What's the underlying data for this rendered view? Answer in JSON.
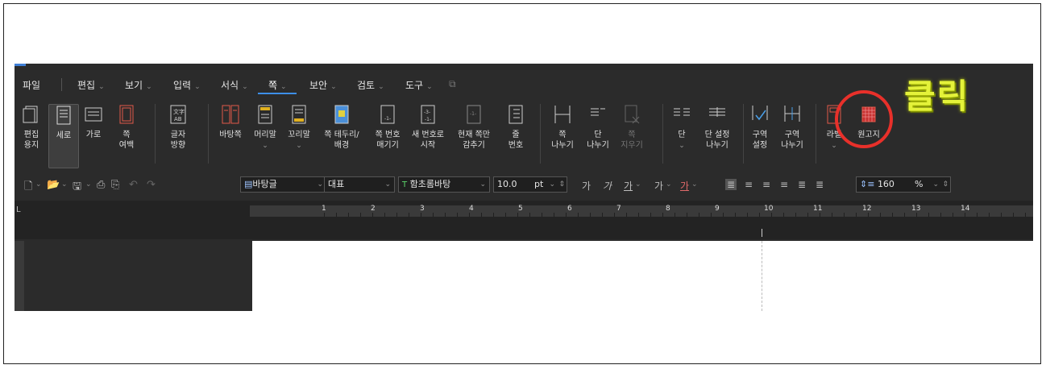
{
  "menu": {
    "items": [
      {
        "label": "파일"
      },
      {
        "label": "편집"
      },
      {
        "label": "보기"
      },
      {
        "label": "입력"
      },
      {
        "label": "서식"
      },
      {
        "label": "쪽"
      },
      {
        "label": "보안"
      },
      {
        "label": "검토"
      },
      {
        "label": "도구"
      }
    ],
    "active": "쪽"
  },
  "ribbon": {
    "buttons": [
      {
        "label": "편집\n용지",
        "icon": "edit-paper-icon"
      },
      {
        "label": "세로",
        "icon": "portrait-icon",
        "selected": true
      },
      {
        "label": "가로",
        "icon": "landscape-icon"
      },
      {
        "label": "쪽\n여백",
        "icon": "page-margin-icon"
      },
      {
        "label": "글자\n방향",
        "icon": "text-direction-icon"
      },
      {
        "label": "바탕쪽",
        "icon": "master-page-icon"
      },
      {
        "label": "머리말",
        "icon": "header-icon"
      },
      {
        "label": "꼬리말",
        "icon": "footer-icon"
      },
      {
        "label": "쪽 테두리/\n배경",
        "icon": "page-border-icon"
      },
      {
        "label": "쪽 번호\n매기기",
        "icon": "page-number-icon"
      },
      {
        "label": "새 번호로\n시작",
        "icon": "new-number-icon"
      },
      {
        "label": "현재 쪽만\n감추기",
        "icon": "hide-current-page-icon"
      },
      {
        "label": "줄\n번호",
        "icon": "line-number-icon"
      },
      {
        "label": "쪽\n나누기",
        "icon": "page-break-icon"
      },
      {
        "label": "단\n나누기",
        "icon": "column-break-icon"
      },
      {
        "label": "쪽\n지우기",
        "icon": "delete-page-icon",
        "disabled": true
      },
      {
        "label": "단",
        "icon": "columns-icon"
      },
      {
        "label": "단 설정\n나누기",
        "icon": "column-settings-icon"
      },
      {
        "label": "구역\n설정",
        "icon": "section-settings-icon"
      },
      {
        "label": "구역\n나누기",
        "icon": "section-break-icon"
      },
      {
        "label": "라벨",
        "icon": "label-icon"
      },
      {
        "label": "원고지",
        "icon": "manuscript-paper-icon"
      }
    ]
  },
  "toolbar": {
    "style": "바탕글",
    "language": "대표",
    "font": "함초롬바탕",
    "size": "10.0",
    "unit": "pt",
    "format_labels": [
      "가",
      "가",
      "가",
      "가",
      "가"
    ],
    "line_spacing": "160",
    "line_spacing_unit": "%"
  },
  "ruler": {
    "numbers": [
      "1",
      "2",
      "3",
      "4",
      "5",
      "6",
      "7",
      "8",
      "9",
      "10",
      "11",
      "12",
      "13",
      "14"
    ],
    "corner": "L"
  },
  "annotation": {
    "text": "클릭",
    "color": "#e4f23a",
    "circle_color": "#e8302a"
  }
}
